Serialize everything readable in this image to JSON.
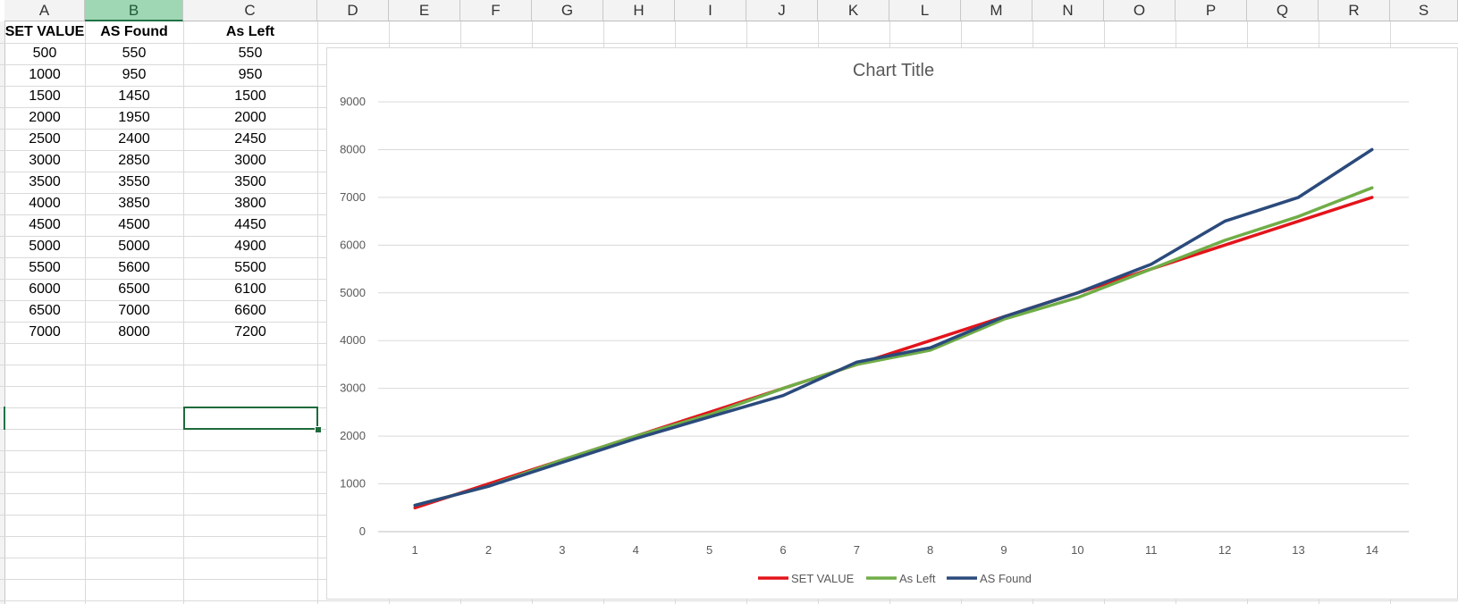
{
  "spreadsheet": {
    "columns": [
      "A",
      "B",
      "C",
      "D",
      "E",
      "F",
      "G",
      "H",
      "I",
      "J",
      "K",
      "L",
      "M",
      "N",
      "O",
      "P",
      "Q",
      "R",
      "S"
    ],
    "selected_column": "B",
    "headers": [
      "SET VALUE",
      "AS Found",
      "As Left"
    ],
    "rows": [
      [
        "500",
        "550",
        "550"
      ],
      [
        "1000",
        "950",
        "950"
      ],
      [
        "1500",
        "1450",
        "1500"
      ],
      [
        "2000",
        "1950",
        "2000"
      ],
      [
        "2500",
        "2400",
        "2450"
      ],
      [
        "3000",
        "2850",
        "3000"
      ],
      [
        "3500",
        "3550",
        "3500"
      ],
      [
        "4000",
        "3850",
        "3800"
      ],
      [
        "4500",
        "4500",
        "4450"
      ],
      [
        "5000",
        "5000",
        "4900"
      ],
      [
        "5500",
        "5600",
        "5500"
      ],
      [
        "6000",
        "6500",
        "6100"
      ],
      [
        "6500",
        "7000",
        "6600"
      ],
      [
        "7000",
        "8000",
        "7200"
      ]
    ],
    "active_cell": "C19"
  },
  "chart_data": {
    "type": "line",
    "title": "Chart Title",
    "x": [
      1,
      2,
      3,
      4,
      5,
      6,
      7,
      8,
      9,
      10,
      11,
      12,
      13,
      14
    ],
    "ylim": [
      0,
      9000
    ],
    "yticks": [
      0,
      1000,
      2000,
      3000,
      4000,
      5000,
      6000,
      7000,
      8000,
      9000
    ],
    "grid": true,
    "legend_position": "bottom",
    "series": [
      {
        "name": "SET VALUE",
        "color": "#e3141b",
        "values": [
          500,
          1000,
          1500,
          2000,
          2500,
          3000,
          3500,
          4000,
          4500,
          5000,
          5500,
          6000,
          6500,
          7000
        ]
      },
      {
        "name": "As Left",
        "color": "#70ad47",
        "values": [
          550,
          950,
          1500,
          2000,
          2450,
          3000,
          3500,
          3800,
          4450,
          4900,
          5500,
          6100,
          6600,
          7200
        ]
      },
      {
        "name": "AS Found",
        "color": "#2b4a7c",
        "values": [
          550,
          950,
          1450,
          1950,
          2400,
          2850,
          3550,
          3850,
          4500,
          5000,
          5600,
          6500,
          7000,
          8000
        ]
      }
    ]
  }
}
